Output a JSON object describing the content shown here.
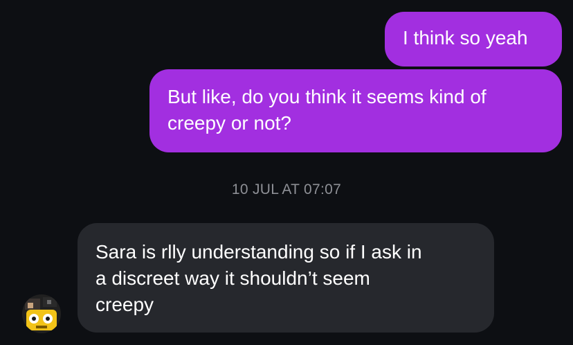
{
  "messages": [
    {
      "direction": "sent",
      "text": "I think so yeah"
    },
    {
      "direction": "sent",
      "text": "But like, do you think it seems kind of\ncreepy or not?"
    },
    {
      "direction": "received",
      "text": "Sara is rlly understanding so if I ask in\na discreet way it shouldn’t seem\ncreepy"
    }
  ],
  "timestamp": "10 JUL AT 07:07",
  "colors": {
    "background": "#0d0f13",
    "sent_bubble": "#a22fe0",
    "received_bubble": "#26282d",
    "timestamp_text": "#8e9096"
  },
  "avatar": {
    "icon": "yellow-robot-avatar"
  }
}
